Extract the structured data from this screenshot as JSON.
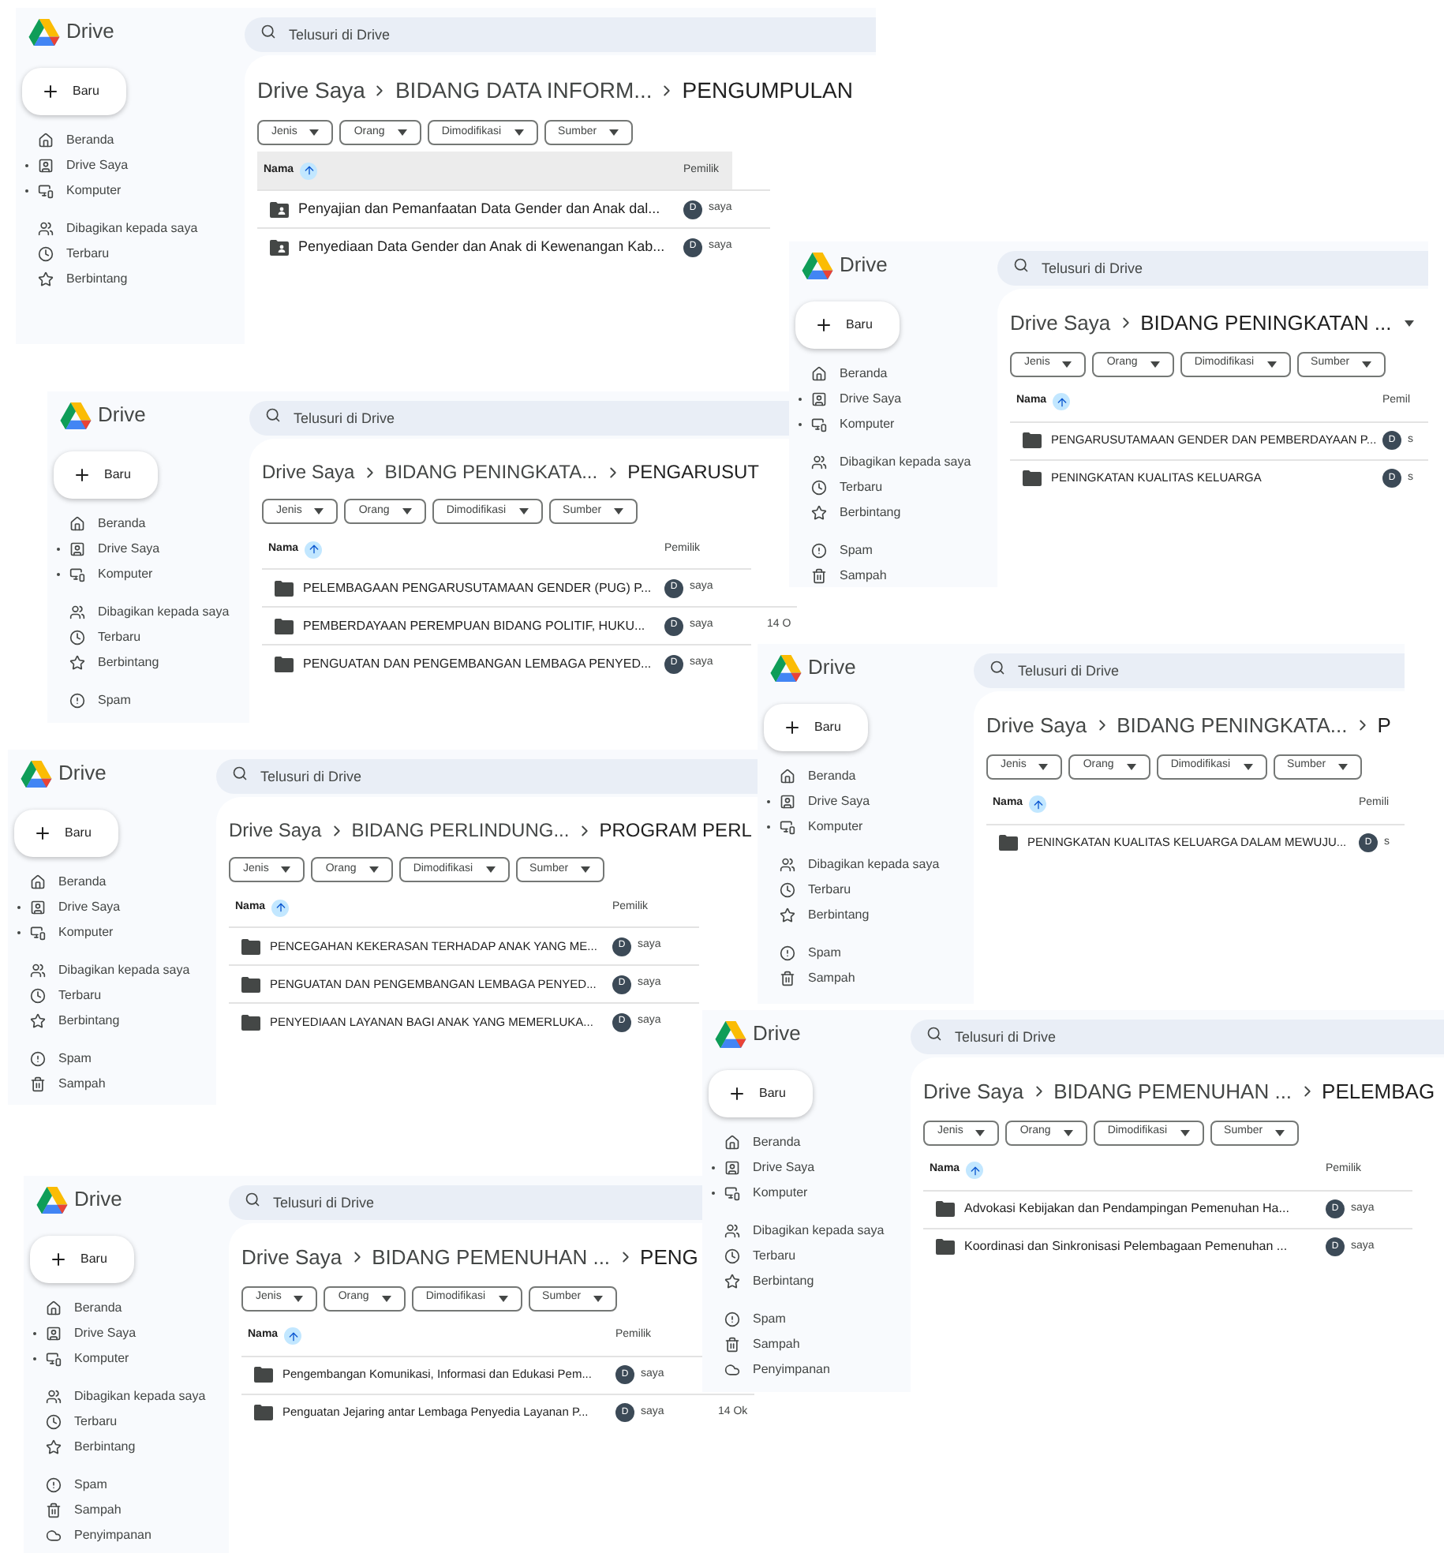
{
  "windows": [
    {
      "app_name": "Drive",
      "search": {
        "placeholder": "Telusuri di Drive"
      },
      "new_button": "Baru",
      "nav_groups": [
        [
          {
            "label": "Beranda",
            "expandable": false
          },
          {
            "label": "Drive Saya",
            "expandable": true
          },
          {
            "label": "Komputer",
            "expandable": true
          }
        ],
        [
          {
            "label": "Dibagikan kepada saya",
            "expandable": false
          },
          {
            "label": "Terbaru",
            "expandable": false
          },
          {
            "label": "Berbintang",
            "expandable": false
          }
        ]
      ],
      "breadcrumb": {
        "crumbs": [
          "Drive Saya",
          "BIDANG DATA INFORM...",
          "PENGUMPULAN"
        ],
        "dropdown": false
      },
      "filters": [
        "Jenis",
        "Orang",
        "Dimodifikasi",
        "Sumber"
      ],
      "table": {
        "header_highlighted": true,
        "columns": [
          "Nama",
          "Pemilik"
        ],
        "rows": [
          {
            "kind": "shared_folder",
            "name": "Penyajian dan Pemanfaatan Data Gender dan Anak dal...",
            "avatar": "D",
            "owner": "saya"
          },
          {
            "kind": "shared_folder",
            "name": "Penyediaan Data Gender dan Anak di Kewenangan Kab...",
            "avatar": "D",
            "owner": "saya"
          }
        ]
      }
    },
    {
      "app_name": "Drive",
      "search": {
        "placeholder": "Telusuri di Drive"
      },
      "new_button": "Baru",
      "nav_groups": [
        [
          {
            "label": "Beranda",
            "expandable": false
          },
          {
            "label": "Drive Saya",
            "expandable": true
          },
          {
            "label": "Komputer",
            "expandable": true
          }
        ],
        [
          {
            "label": "Dibagikan kepada saya",
            "expandable": false
          },
          {
            "label": "Terbaru",
            "expandable": false
          },
          {
            "label": "Berbintang",
            "expandable": false
          }
        ],
        [
          {
            "label": "Spam",
            "expandable": false
          },
          {
            "label": "Sampah",
            "expandable": false
          }
        ]
      ],
      "breadcrumb": {
        "crumbs": [
          "Drive Saya",
          "BIDANG PENINGKATAN ..."
        ],
        "dropdown": true
      },
      "filters": [
        "Jenis",
        "Orang",
        "Dimodifikasi",
        "Sumber"
      ],
      "table": {
        "header_highlighted": false,
        "columns": [
          "Nama",
          "Pemil"
        ],
        "rows": [
          {
            "kind": "folder",
            "name": "PENGARUSUTAMAAN GENDER DAN PEMBERDAYAAN P...",
            "avatar": "D",
            "owner": "s"
          },
          {
            "kind": "folder",
            "name": "PENINGKATAN KUALITAS KELUARGA",
            "avatar": "D",
            "owner": "s"
          }
        ]
      }
    },
    {
      "app_name": "Drive",
      "search": {
        "placeholder": "Telusuri di Drive"
      },
      "new_button": "Baru",
      "nav_groups": [
        [
          {
            "label": "Beranda",
            "expandable": false
          },
          {
            "label": "Drive Saya",
            "expandable": true
          },
          {
            "label": "Komputer",
            "expandable": true
          }
        ],
        [
          {
            "label": "Dibagikan kepada saya",
            "expandable": false
          },
          {
            "label": "Terbaru",
            "expandable": false
          },
          {
            "label": "Berbintang",
            "expandable": false
          }
        ],
        [
          {
            "label": "Spam",
            "expandable": false
          }
        ]
      ],
      "breadcrumb": {
        "crumbs": [
          "Drive Saya",
          "BIDANG PENINGKATA...",
          "PENGARUSUT"
        ],
        "dropdown": false
      },
      "filters": [
        "Jenis",
        "Orang",
        "Dimodifikasi",
        "Sumber"
      ],
      "table": {
        "header_highlighted": false,
        "columns": [
          "Nama",
          "Pemilik"
        ],
        "rows": [
          {
            "kind": "folder",
            "name": "PELEMBAGAAN PENGARUSUTAMAAN GENDER (PUG) P...",
            "avatar": "D",
            "owner": "saya"
          },
          {
            "kind": "folder",
            "name": "PEMBERDAYAAN PEREMPUAN BIDANG POLITIF, HUKU...",
            "avatar": "D",
            "owner": "saya",
            "date": "14 O"
          },
          {
            "kind": "folder",
            "name": "PENGUATAN DAN PENGEMBANGAN LEMBAGA PENYED...",
            "avatar": "D",
            "owner": "saya"
          }
        ]
      }
    },
    {
      "app_name": "Drive",
      "search": {
        "placeholder": "Telusuri di Drive"
      },
      "new_button": "Baru",
      "nav_groups": [
        [
          {
            "label": "Beranda",
            "expandable": false
          },
          {
            "label": "Drive Saya",
            "expandable": true
          },
          {
            "label": "Komputer",
            "expandable": true
          }
        ],
        [
          {
            "label": "Dibagikan kepada saya",
            "expandable": false
          },
          {
            "label": "Terbaru",
            "expandable": false
          },
          {
            "label": "Berbintang",
            "expandable": false
          }
        ],
        [
          {
            "label": "Spam",
            "expandable": false
          },
          {
            "label": "Sampah",
            "expandable": false
          }
        ]
      ],
      "breadcrumb": {
        "crumbs": [
          "Drive Saya",
          "BIDANG PENINGKATA...",
          "P"
        ],
        "dropdown": false
      },
      "filters": [
        "Jenis",
        "Orang",
        "Dimodifikasi",
        "Sumber"
      ],
      "table": {
        "header_highlighted": false,
        "columns": [
          "Nama",
          "Pemili"
        ],
        "rows": [
          {
            "kind": "folder",
            "name": "PENINGKATAN KUALITAS KELUARGA DALAM MEWUJU...",
            "avatar": "D",
            "owner": "s"
          }
        ]
      }
    },
    {
      "app_name": "Drive",
      "search": {
        "placeholder": "Telusuri di Drive"
      },
      "new_button": "Baru",
      "nav_groups": [
        [
          {
            "label": "Beranda",
            "expandable": false
          },
          {
            "label": "Drive Saya",
            "expandable": true
          },
          {
            "label": "Komputer",
            "expandable": true
          }
        ],
        [
          {
            "label": "Dibagikan kepada saya",
            "expandable": false
          },
          {
            "label": "Terbaru",
            "expandable": false
          },
          {
            "label": "Berbintang",
            "expandable": false
          }
        ],
        [
          {
            "label": "Spam",
            "expandable": false
          },
          {
            "label": "Sampah",
            "expandable": false
          }
        ]
      ],
      "breadcrumb": {
        "crumbs": [
          "Drive Saya",
          "BIDANG PERLINDUNG...",
          "PROGRAM PERL"
        ],
        "dropdown": false
      },
      "filters": [
        "Jenis",
        "Orang",
        "Dimodifikasi",
        "Sumber"
      ],
      "table": {
        "header_highlighted": false,
        "columns": [
          "Nama",
          "Pemilik"
        ],
        "rows": [
          {
            "kind": "folder",
            "name": "PENCEGAHAN KEKERASAN TERHADAP ANAK YANG ME...",
            "avatar": "D",
            "owner": "saya"
          },
          {
            "kind": "folder",
            "name": "PENGUATAN DAN PENGEMBANGAN LEMBAGA PENYED...",
            "avatar": "D",
            "owner": "saya"
          },
          {
            "kind": "folder",
            "name": "PENYEDIAAN LAYANAN BAGI ANAK YANG MEMERLUKA...",
            "avatar": "D",
            "owner": "saya"
          }
        ]
      }
    },
    {
      "app_name": "Drive",
      "search": {
        "placeholder": "Telusuri di Drive"
      },
      "new_button": "Baru",
      "nav_groups": [
        [
          {
            "label": "Beranda",
            "expandable": false
          },
          {
            "label": "Drive Saya",
            "expandable": true
          },
          {
            "label": "Komputer",
            "expandable": true
          }
        ],
        [
          {
            "label": "Dibagikan kepada saya",
            "expandable": false
          },
          {
            "label": "Terbaru",
            "expandable": false
          },
          {
            "label": "Berbintang",
            "expandable": false
          }
        ],
        [
          {
            "label": "Spam",
            "expandable": false
          },
          {
            "label": "Sampah",
            "expandable": false
          },
          {
            "label": "Penyimpanan",
            "expandable": false
          }
        ]
      ],
      "breadcrumb": {
        "crumbs": [
          "Drive Saya",
          "BIDANG PEMENUHAN ...",
          "PELEMBAG"
        ],
        "dropdown": false
      },
      "filters": [
        "Jenis",
        "Orang",
        "Dimodifikasi",
        "Sumber"
      ],
      "table": {
        "header_highlighted": false,
        "columns": [
          "Nama",
          "Pemilik"
        ],
        "rows": [
          {
            "kind": "folder",
            "name": "Advokasi Kebijakan dan Pendampingan Pemenuhan Ha...",
            "avatar": "D",
            "owner": "saya"
          },
          {
            "kind": "folder",
            "name": "Koordinasi dan Sinkronisasi Pelembagaan Pemenuhan ...",
            "avatar": "D",
            "owner": "saya"
          }
        ]
      }
    },
    {
      "app_name": "Drive",
      "search": {
        "placeholder": "Telusuri di Drive"
      },
      "new_button": "Baru",
      "nav_groups": [
        [
          {
            "label": "Beranda",
            "expandable": false
          },
          {
            "label": "Drive Saya",
            "expandable": true
          },
          {
            "label": "Komputer",
            "expandable": true
          }
        ],
        [
          {
            "label": "Dibagikan kepada saya",
            "expandable": false
          },
          {
            "label": "Terbaru",
            "expandable": false
          },
          {
            "label": "Berbintang",
            "expandable": false
          }
        ],
        [
          {
            "label": "Spam",
            "expandable": false
          },
          {
            "label": "Sampah",
            "expandable": false
          },
          {
            "label": "Penyimpanan",
            "expandable": false
          }
        ]
      ],
      "breadcrumb": {
        "crumbs": [
          "Drive Saya",
          "BIDANG PEMENUHAN ...",
          "PENG"
        ],
        "dropdown": false
      },
      "filters": [
        "Jenis",
        "Orang",
        "Dimodifikasi",
        "Sumber"
      ],
      "table": {
        "header_highlighted": false,
        "columns": [
          "Nama",
          "Pemilik"
        ],
        "rows": [
          {
            "kind": "folder",
            "name": "Pengembangan Komunikasi, Informasi dan Edukasi Pem...",
            "avatar": "D",
            "owner": "saya"
          },
          {
            "kind": "folder",
            "name": "Penguatan Jejaring antar Lembaga Penyedia Layanan P...",
            "avatar": "D",
            "owner": "saya",
            "date": "14 Ok"
          }
        ]
      }
    }
  ]
}
